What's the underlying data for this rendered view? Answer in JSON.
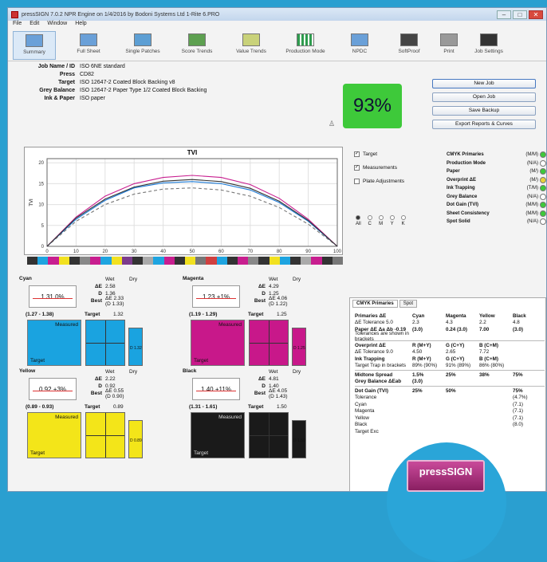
{
  "window": {
    "title": "pressSIGN 7.0.2 NPR Engine on 1/4/2016 by Bodoni Systems Ltd 1-Rite 6.PRO",
    "min": "–",
    "max": "□",
    "close": "✕"
  },
  "menu": [
    "File",
    "Edit",
    "Window",
    "Help"
  ],
  "toolbar": [
    {
      "label": "Summary",
      "icon": "summary-icon"
    },
    {
      "label": "Full Sheet",
      "icon": "full-sheet-icon"
    },
    {
      "label": "Single Patches",
      "icon": "single-patches-icon"
    },
    {
      "label": "Score Trends",
      "icon": "score-trends-icon"
    },
    {
      "label": "Value Trends",
      "icon": "value-trends-icon"
    },
    {
      "label": "Production Mode",
      "icon": "production-mode-icon"
    },
    {
      "label": "NPDC",
      "icon": "npdc-icon"
    },
    {
      "label": "SoftProof",
      "icon": "softproof-icon"
    },
    {
      "label": "Print",
      "icon": "print-icon"
    },
    {
      "label": "Job Settings",
      "icon": "gear-icon"
    }
  ],
  "info": [
    {
      "k": "Job Name / ID",
      "v": "ISO 6NE standard"
    },
    {
      "k": "Press",
      "v": "CD82"
    },
    {
      "k": "Target",
      "v": "ISO 12647-2 Coated Block Backing v8"
    },
    {
      "k": "Grey Balance",
      "v": "ISO 12647-2 Paper Type 1/2 Coated Block Backing"
    },
    {
      "k": "Ink & Paper",
      "v": "ISO paper"
    }
  ],
  "score": "93%",
  "buttons": [
    "New Job",
    "Open Job",
    "Save Backup",
    "Export Reports & Curves"
  ],
  "checks": [
    {
      "label": "Target",
      "checked": true
    },
    {
      "label": "Measurements",
      "checked": true
    },
    {
      "label": "Plate Adjustments",
      "checked": false
    }
  ],
  "radios": [
    "All",
    "C",
    "M",
    "Y",
    "K"
  ],
  "primaries": [
    {
      "label": "CMYK Primaries",
      "status": "(M/M)",
      "color": "#3ec93a"
    },
    {
      "label": "Production Mode",
      "status": "(N/A)",
      "color": "#ffffff"
    },
    {
      "label": "Paper",
      "status": "(M/)",
      "color": "#3ec93a"
    },
    {
      "label": "Overprint ΔE",
      "status": "(M/)",
      "color": "#e8d23a"
    },
    {
      "label": "Ink Trapping",
      "status": "(T/M)",
      "color": "#3ec93a"
    },
    {
      "label": "Grey Balance",
      "status": "(N/A)",
      "color": "#ffffff"
    },
    {
      "label": "Dot Gain (TVI)",
      "status": "(M/M)",
      "color": "#3ec93a"
    },
    {
      "label": "Sheet Consistency",
      "status": "(M/M)",
      "color": "#3ec93a"
    },
    {
      "label": "Spot Solid",
      "status": "(N/A)",
      "color": "#ffffff"
    }
  ],
  "chart_data": {
    "type": "line",
    "title": "TVI",
    "ylabel": "TVI",
    "xlabel": "",
    "x": [
      0,
      10,
      20,
      30,
      40,
      50,
      60,
      70,
      80,
      90,
      100
    ],
    "xlim": [
      0,
      100
    ],
    "ylim": [
      0,
      21
    ],
    "yticks": [
      0,
      5,
      10,
      15,
      20
    ],
    "series": [
      {
        "color": "#1b7ad6",
        "dashed": false,
        "values": [
          0,
          6.5,
          11,
          14,
          15.2,
          15.5,
          15,
          13.5,
          10.5,
          6,
          0
        ]
      },
      {
        "color": "#c81e8f",
        "dashed": false,
        "values": [
          0,
          7,
          12,
          15,
          16.5,
          17,
          16.5,
          14.8,
          11.5,
          6.5,
          0
        ]
      },
      {
        "color": "#777777",
        "dashed": true,
        "values": [
          0,
          6,
          10,
          12.5,
          13.7,
          14,
          13.5,
          12,
          9.3,
          5.3,
          0
        ]
      },
      {
        "color": "#333333",
        "dashed": false,
        "values": [
          0,
          6.8,
          11.3,
          14.2,
          15.6,
          16,
          15.5,
          13.9,
          10.8,
          6.2,
          0
        ]
      }
    ]
  },
  "strip": [
    "#333333",
    "#1ea4e0",
    "#c81e8f",
    "#f2e11f",
    "#333333",
    "#888888",
    "#c81e8f",
    "#1ea4e0",
    "#f2e11f",
    "#7c3c8c",
    "#333333",
    "#aaaaaa",
    "#1ea4e0",
    "#c81e8f",
    "#333333",
    "#f2e11f",
    "#777777",
    "#d04040",
    "#1ea4e0",
    "#333333",
    "#c81e8f",
    "#888888",
    "#333333",
    "#f2e11f",
    "#1ea4e0",
    "#333333",
    "#aaaaaa",
    "#c81e8f",
    "#333333",
    "#777777"
  ],
  "quads": [
    {
      "name": "Cyan",
      "value": "1.31 0%",
      "range": "(1.27 - 1.38)",
      "target": "1.32",
      "head": [
        "",
        "Wet",
        "Dry"
      ],
      "rows": [
        [
          "ΔE",
          "2.58",
          ""
        ],
        [
          "D",
          "1.36",
          ""
        ],
        [
          "Best",
          "ΔE 2.33 (D 1.33)",
          ""
        ]
      ],
      "swatch": "#1aa3e0",
      "measured": "Measured",
      "tlabel": "Target",
      "dotcolor": "#1aa3e0",
      "small": "D 1.32"
    },
    {
      "name": "Magenta",
      "value": "1.23 +1%",
      "range": "(1.19 - 1.29)",
      "target": "1.25",
      "head": [
        "",
        "Wet",
        "Dry"
      ],
      "rows": [
        [
          "ΔE",
          "4.29",
          ""
        ],
        [
          "D",
          "1.25",
          ""
        ],
        [
          "Best",
          "ΔE 4.06 (D 1.22)",
          ""
        ]
      ],
      "swatch": "#c8188a",
      "measured": "Measured",
      "tlabel": "Target",
      "dotcolor": "#c8188a",
      "small": "D 1.25"
    },
    {
      "name": "Yellow",
      "value": "0.92 +3%",
      "range": "(0.89 - 0.93)",
      "target": "0.89",
      "head": [
        "",
        "Wet",
        "Dry"
      ],
      "rows": [
        [
          "ΔE",
          "2.22",
          ""
        ],
        [
          "D",
          "0.92",
          ""
        ],
        [
          "Best",
          "ΔE 0.55 (D 0.90)",
          ""
        ]
      ],
      "swatch": "#f3e519",
      "measured": "Measured",
      "tlabel": "Target",
      "dotcolor": "#d8c000",
      "small": "D 0.89"
    },
    {
      "name": "Black",
      "value": "1.40 +11%",
      "range": "(1.31 - 1.61)",
      "target": "1.50",
      "head": [
        "",
        "Wet",
        "Dry"
      ],
      "rows": [
        [
          "ΔE",
          "4.81",
          ""
        ],
        [
          "D",
          "1.40",
          ""
        ],
        [
          "Best",
          "ΔE 4.05 (D 1.43)",
          ""
        ]
      ],
      "swatch": "#1a1a1a",
      "measured": "Measured",
      "tlabel": "Target",
      "dotcolor": "#555555",
      "small": "D 1.50"
    }
  ],
  "cmyk": {
    "tabs": [
      "CMYK Primaries",
      "Spot"
    ],
    "rows": [
      {
        "cells": [
          "Primaries ΔE",
          "Cyan",
          "Magenta",
          "Yellow",
          "Black"
        ],
        "bold": true
      },
      {
        "cells": [
          "ΔE Tolerance 5.0",
          "2.3",
          "4.3",
          "2.2",
          "4.8"
        ],
        "bold": false
      },
      {
        "cells": [
          "Paper ΔE Δa Δb  -0.19",
          "(3.0)",
          "0.24 (3.0)",
          "7.00",
          "(3.0)"
        ],
        "bold": true
      },
      {
        "cells": [
          "Tolerances are shown in brackets",
          "",
          "",
          "",
          ""
        ],
        "bold": false
      },
      {
        "cells": [
          "Overprint ΔE",
          "R (M+Y)",
          "G (C+Y)",
          "B (C+M)",
          ""
        ],
        "bold": true
      },
      {
        "cells": [
          "ΔE Tolerance 9.0",
          "4.50",
          "2.65",
          "7.72",
          ""
        ],
        "bold": false
      },
      {
        "cells": [
          "Ink Trapping",
          "R (M+Y)",
          "G (C+Y)",
          "B (C+M)",
          ""
        ],
        "bold": true
      },
      {
        "cells": [
          "Target Trap in brackets",
          "89% (90%)",
          "91% (89%)",
          "86% (80%)",
          ""
        ],
        "bold": false
      },
      {
        "cells": [
          "Midtone Spread",
          "1.5%",
          "25%",
          "38%",
          "75%"
        ],
        "bold": true
      },
      {
        "cells": [
          "Grey Balance ΔEab",
          "(3.0)",
          "",
          "",
          ""
        ],
        "bold": true
      },
      {
        "cells": [
          "Dot Gain (TVI)",
          "25%",
          "50%",
          "",
          "75%"
        ],
        "bold": true
      },
      {
        "cells": [
          "Tolerance",
          "",
          "",
          "",
          "(4.7%)"
        ],
        "bold": false
      },
      {
        "cells": [
          "Cyan",
          "",
          "",
          "",
          "(7.1)"
        ],
        "bold": false
      },
      {
        "cells": [
          "Magenta",
          "",
          "",
          "",
          "(7.1)"
        ],
        "bold": false
      },
      {
        "cells": [
          "Yellow",
          "",
          "",
          "",
          "(7.1)"
        ],
        "bold": false
      },
      {
        "cells": [
          "Black",
          "",
          "",
          "",
          "(8.0)"
        ],
        "bold": false
      },
      {
        "cells": [
          "Target Exc",
          "",
          "",
          "",
          ""
        ],
        "bold": false
      }
    ]
  },
  "badge": "pressSIGN"
}
